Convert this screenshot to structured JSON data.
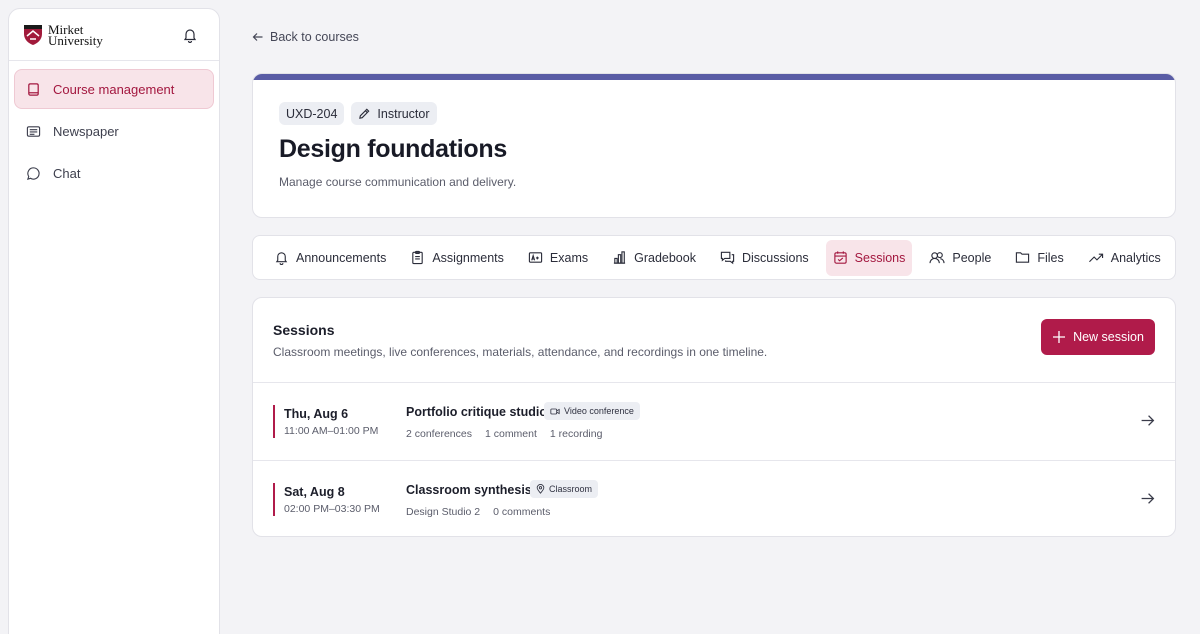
{
  "brand": {
    "name_line1": "Mirket",
    "name_line2": "University"
  },
  "sidebar": {
    "items": [
      {
        "label": "Course management",
        "icon": "book-icon",
        "active": true
      },
      {
        "label": "Newspaper",
        "icon": "newspaper-icon",
        "active": false
      },
      {
        "label": "Chat",
        "icon": "chat-icon",
        "active": false
      }
    ]
  },
  "back_link": "Back to courses",
  "course": {
    "code": "UXD-204",
    "role": "Instructor",
    "title": "Design foundations",
    "subtitle": "Manage course communication and delivery.",
    "accent_color": "#595ca5"
  },
  "tabs": [
    {
      "label": "Announcements",
      "icon": "bell-icon"
    },
    {
      "label": "Assignments",
      "icon": "clipboard-icon"
    },
    {
      "label": "Exams",
      "icon": "grade-icon"
    },
    {
      "label": "Gradebook",
      "icon": "bar-chart-icon"
    },
    {
      "label": "Discussions",
      "icon": "discussion-icon"
    },
    {
      "label": "Sessions",
      "icon": "calendar-icon",
      "active": true
    },
    {
      "label": "People",
      "icon": "people-icon"
    },
    {
      "label": "Files",
      "icon": "folder-icon"
    },
    {
      "label": "Analytics",
      "icon": "trend-icon"
    }
  ],
  "sessions": {
    "title": "Sessions",
    "description": "Classroom meetings, live conferences, materials, attendance, and recordings in one timeline.",
    "new_button": "New session",
    "primary_color": "#b01b4a",
    "items": [
      {
        "date": "Thu, Aug 6",
        "time": "11:00 AM–01:00 PM",
        "title": "Portfolio critique studio",
        "type": "Video conference",
        "type_icon": "video-icon",
        "meta": [
          "2 conferences",
          "1 comment",
          "1 recording"
        ]
      },
      {
        "date": "Sat, Aug 8",
        "time": "02:00 PM–03:30 PM",
        "title": "Classroom synthesis",
        "type": "Classroom",
        "type_icon": "location-pin-icon",
        "meta": [
          "Design Studio 2",
          "0 comments"
        ]
      }
    ]
  }
}
